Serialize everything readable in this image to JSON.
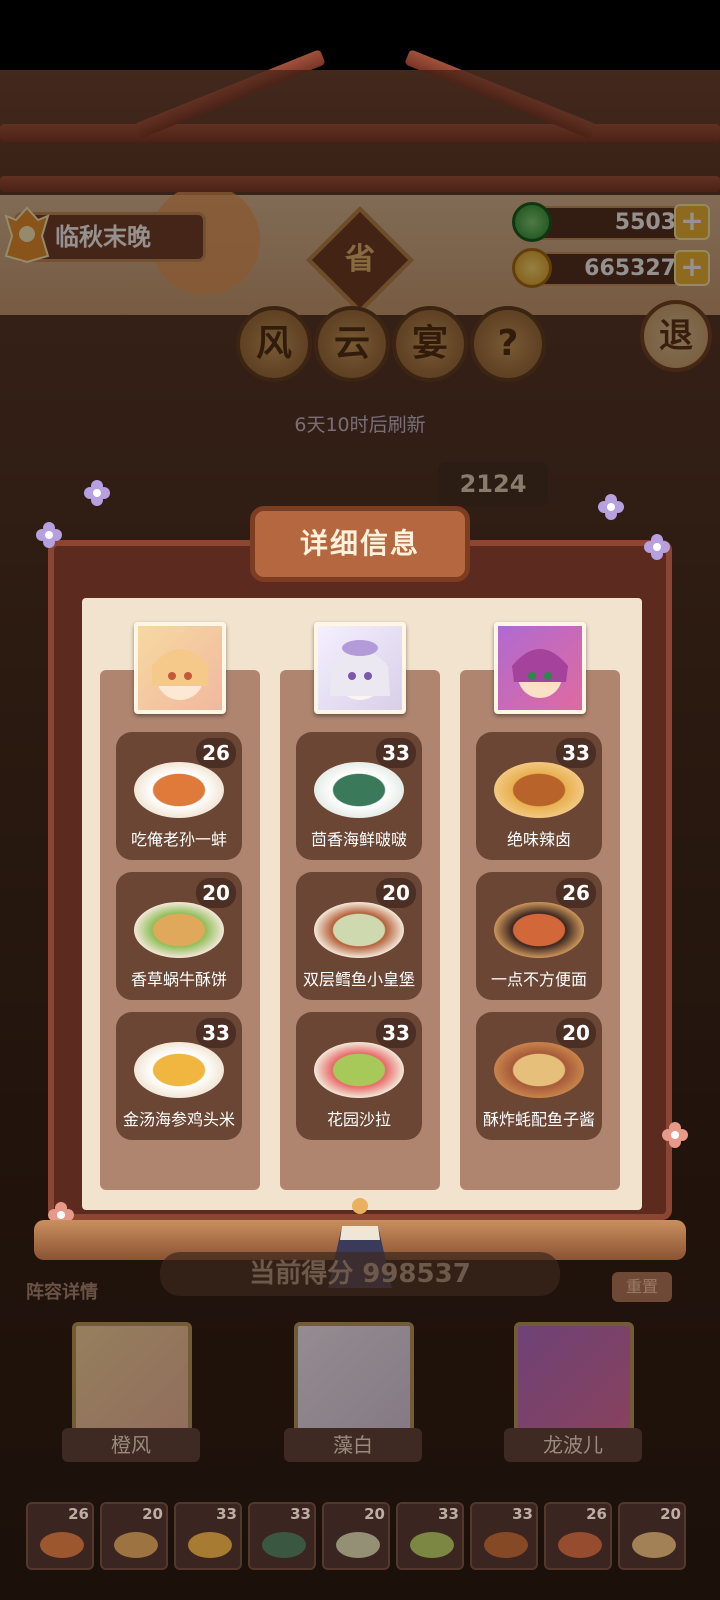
{
  "player": {
    "name": "临秋末晚"
  },
  "currency": {
    "jade": "5503",
    "coins": "665327",
    "plus": "+"
  },
  "header": {
    "province": "省",
    "title_chars": [
      "风",
      "云",
      "宴"
    ],
    "help": "?",
    "exit": "退",
    "refresh_text": "6天10时后刷新",
    "rank_number": "2124"
  },
  "panel": {
    "title": "详细信息",
    "columns": [
      {
        "hero": "橙风",
        "dishes": [
          {
            "name": "吃俺老孙一蚌",
            "level": "26",
            "color": "#e07a3a"
          },
          {
            "name": "香草蜗牛酥饼",
            "level": "20",
            "color": "#e0a85a"
          },
          {
            "name": "金汤海参鸡头米",
            "level": "33",
            "color": "#f0b640"
          }
        ]
      },
      {
        "hero": "藻白",
        "dishes": [
          {
            "name": "茴香海鲜啵啵",
            "level": "33",
            "color": "#3a7a5a"
          },
          {
            "name": "双层鳕鱼小皇堡",
            "level": "20",
            "color": "#cfd9b0"
          },
          {
            "name": "花园沙拉",
            "level": "33",
            "color": "#a7c95a"
          }
        ]
      },
      {
        "hero": "龙波儿",
        "dishes": [
          {
            "name": "绝味辣卤",
            "level": "33",
            "color": "#b8632a"
          },
          {
            "name": "一点不方便面",
            "level": "26",
            "color": "#d2683a"
          },
          {
            "name": "酥炸蚝配鱼子酱",
            "level": "20",
            "color": "#e6c07a"
          }
        ]
      }
    ]
  },
  "footer": {
    "lineup": "阵容详情",
    "score_text": "当前得分 998537",
    "reset": "重置",
    "slots": [
      "26",
      "20",
      "33",
      "33",
      "20",
      "33",
      "33",
      "26",
      "20"
    ]
  }
}
